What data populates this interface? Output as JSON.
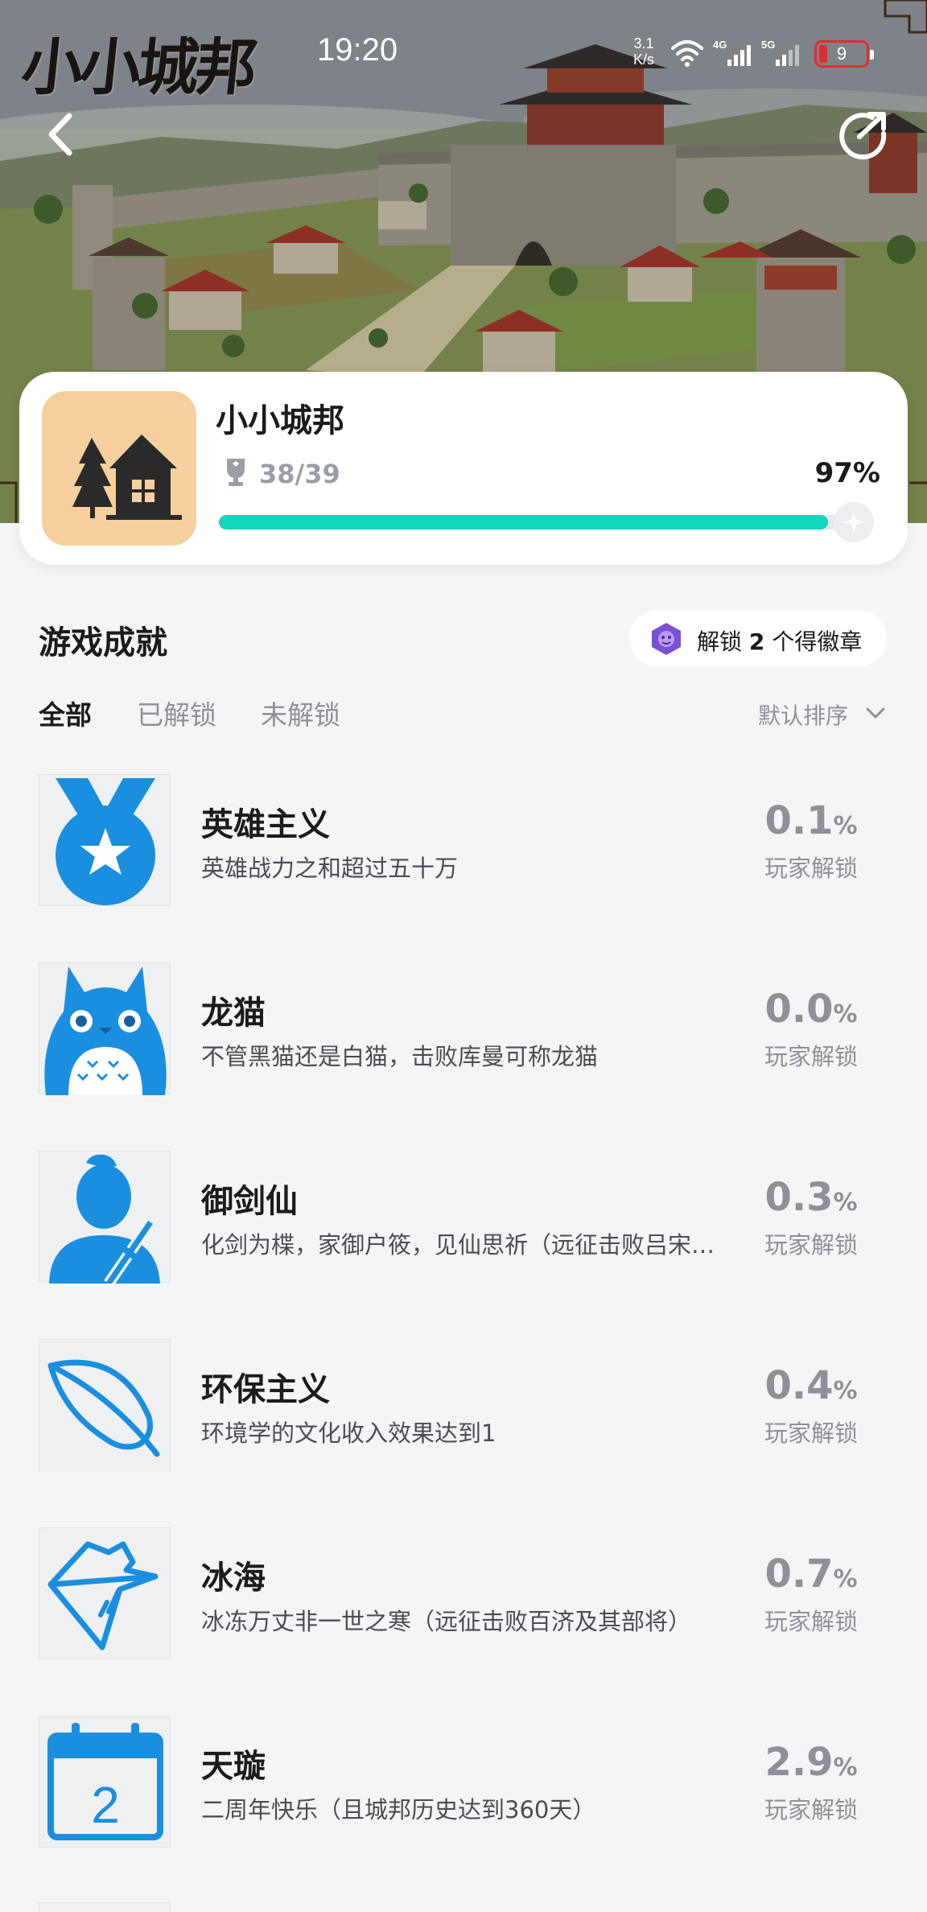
{
  "status_bar": {
    "time": "19:20",
    "net_speed_top": "3.1",
    "net_speed_unit": "K/s",
    "battery_level": "9"
  },
  "hero": {
    "game_logo_text": "小小城邦"
  },
  "game": {
    "name": "小小城邦",
    "progress_count": "38/39",
    "progress_percent": "97%",
    "progress_fraction": 0.97
  },
  "section": {
    "title": "游戏成就",
    "badge_prefix": "解锁",
    "badge_count": "2",
    "badge_suffix": "个得徽章",
    "tabs": [
      "全部",
      "已解锁",
      "未解锁"
    ],
    "sort_label": "默认排序"
  },
  "achievements": [
    {
      "name": "英雄主义",
      "desc": "英雄战力之和超过五十万",
      "rate": "0.1",
      "pct": "%",
      "label": "玩家解锁",
      "icon": "medal-icon"
    },
    {
      "name": "龙猫",
      "desc": "不管黑猫还是白猫，击败库曼可称龙猫",
      "rate": "0.0",
      "pct": "%",
      "label": "玩家解锁",
      "icon": "totoro-icon"
    },
    {
      "name": "御剑仙",
      "desc": "化剑为楪，家御户筱，见仙思祈（远征击败吕宋…",
      "rate": "0.3",
      "pct": "%",
      "label": "玩家解锁",
      "icon": "swordsman-icon"
    },
    {
      "name": "环保主义",
      "desc": "环境学的文化收入效果达到1",
      "rate": "0.4",
      "pct": "%",
      "label": "玩家解锁",
      "icon": "leaf-icon"
    },
    {
      "name": "冰海",
      "desc": "冰冻万丈非一世之寒（远征击败百济及其部将）",
      "rate": "0.7",
      "pct": "%",
      "label": "玩家解锁",
      "icon": "iceberg-icon"
    },
    {
      "name": "天璇",
      "desc": "二周年快乐（且城邦历史达到360天）",
      "rate": "2.9",
      "pct": "%",
      "label": "玩家解锁",
      "icon": "calendar-icon",
      "icon_text": "2"
    }
  ],
  "colors": {
    "accent": "#12d6bd",
    "icon_blue": "#1a8fe0",
    "game_icon_bg": "#f5d09e",
    "badge_purple": "#7b4fd6"
  }
}
